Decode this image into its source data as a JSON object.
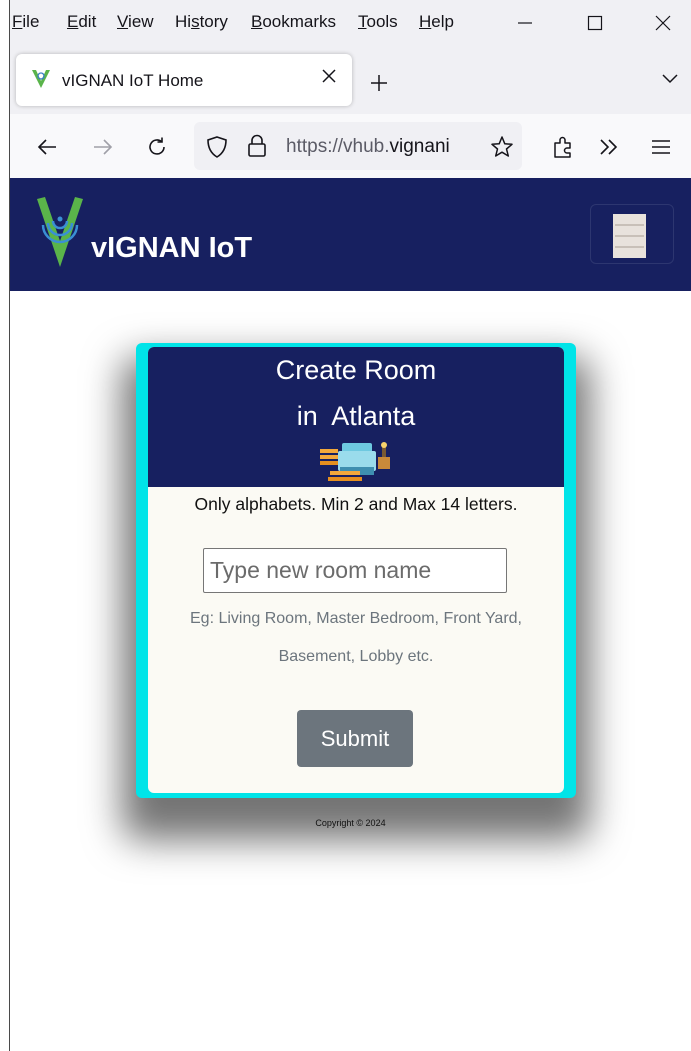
{
  "menu": {
    "items": [
      {
        "label": "File",
        "key": "F"
      },
      {
        "label": "Edit",
        "key": "E"
      },
      {
        "label": "View",
        "key": "V"
      },
      {
        "label": "History",
        "key": "s"
      },
      {
        "label": "Bookmarks",
        "key": "B"
      },
      {
        "label": "Tools",
        "key": "T"
      },
      {
        "label": "Help",
        "key": "H"
      }
    ]
  },
  "window_controls": {
    "minimize": "—",
    "maximize": "☐",
    "close": "✕"
  },
  "tab": {
    "title": "vIGNAN IoT Home",
    "close": "✕",
    "new_tab": "+",
    "list": "⌄"
  },
  "urlbar": {
    "prefix": "https://vhub.",
    "domain": "vignani"
  },
  "site": {
    "brand": "vIGNAN IoT"
  },
  "card": {
    "title_line1": "Create Room",
    "title_line2": "in  Atlanta",
    "rule": "Only alphabets. Min 2 and Max 14 letters.",
    "input_placeholder": "Type new room name",
    "example_line1": "Eg: Living Room, Master Bedroom, Front Yard,",
    "example_line2": "Basement, Lobby etc.",
    "submit_label": "Submit"
  },
  "footer": {
    "copyright": "Copyright © 2024"
  },
  "colors": {
    "header_navy": "#172060",
    "card_border_cyan": "#00e4e8",
    "button_gray": "#6c757d"
  },
  "icons": [
    "back-arrow-icon",
    "forward-arrow-icon",
    "reload-icon",
    "tracking-shield-icon",
    "lock-icon",
    "bookmark-star-icon",
    "extensions-icon",
    "overflow-chevron-icon",
    "app-menu-icon",
    "room-furniture-icon",
    "vignan-logo-icon",
    "hamburger-menu-icon"
  ]
}
